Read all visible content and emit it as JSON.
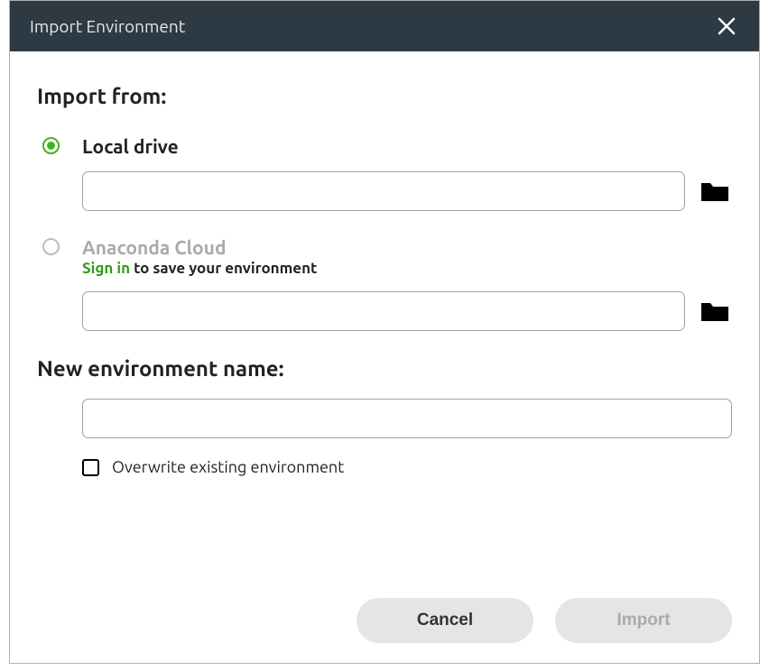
{
  "dialog": {
    "title": "Import Environment"
  },
  "section": {
    "import_from": "Import from:",
    "new_env_name": "New environment name:"
  },
  "options": {
    "local": {
      "label": "Local drive",
      "value": ""
    },
    "cloud": {
      "label": "Anaconda Cloud",
      "signin_text": "Sign in",
      "helper_rest": " to save your environment",
      "value": ""
    }
  },
  "env_name": {
    "value": ""
  },
  "overwrite": {
    "label": "Overwrite existing environment",
    "checked": false
  },
  "buttons": {
    "cancel": "Cancel",
    "import": "Import"
  }
}
